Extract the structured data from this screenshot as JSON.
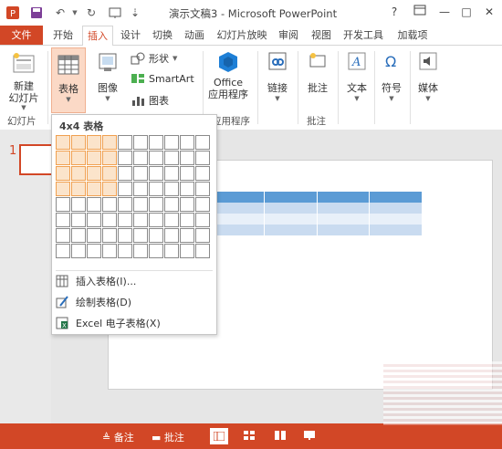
{
  "app": {
    "title": "演示文稿3 - Microsoft PowerPoint"
  },
  "window": {
    "help": "?",
    "minimize": "—",
    "maximize": "□",
    "close": "✕"
  },
  "tabs": [
    "文件",
    "开始",
    "插入",
    "设计",
    "切换",
    "动画",
    "幻灯片放映",
    "审阅",
    "视图",
    "开发工具",
    "加载项"
  ],
  "ribbon": {
    "new_slide": "新建\n幻灯片",
    "table": "表格",
    "image": "图像",
    "shapes": "形状",
    "smartart": "SmartArt",
    "chart": "图表",
    "office_apps": "Office\n应用程序",
    "links": "链接",
    "comment": "批注",
    "text": "文本",
    "symbol": "符号",
    "media": "媒体",
    "groups": {
      "slides": "幻灯片",
      "apps": "应用程序",
      "comments": "批注"
    }
  },
  "dropdown": {
    "header": "4x4 表格",
    "grid": {
      "cols": 10,
      "rows": 8,
      "selected_cols": 4,
      "selected_rows": 4
    },
    "items": [
      {
        "label": "插入表格(I)...",
        "icon": "table-insert-icon"
      },
      {
        "label": "绘制表格(D)",
        "icon": "pencil-table-icon"
      },
      {
        "label": "Excel 电子表格(X)",
        "icon": "excel-icon"
      }
    ]
  },
  "slide": {
    "thumbnail_number": "1"
  },
  "status": {
    "notes": "备注",
    "comments": "批注"
  },
  "colors": {
    "accent": "#d24726",
    "table_header": "#5b9bd5",
    "table_row": "#deeaf6"
  }
}
